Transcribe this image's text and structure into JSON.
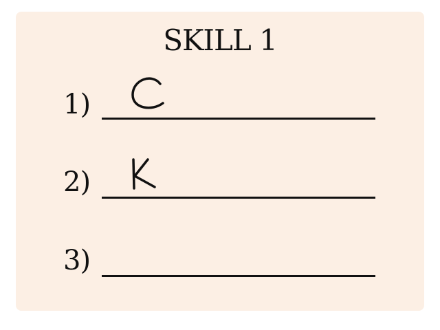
{
  "worksheet": {
    "title": "SKILL 1",
    "items": [
      {
        "number": "1)",
        "answer": "C"
      },
      {
        "number": "2)",
        "answer": "K"
      },
      {
        "number": "3)",
        "answer": ""
      }
    ]
  },
  "colors": {
    "card_background": "#fcefe4",
    "ink": "#111111"
  }
}
